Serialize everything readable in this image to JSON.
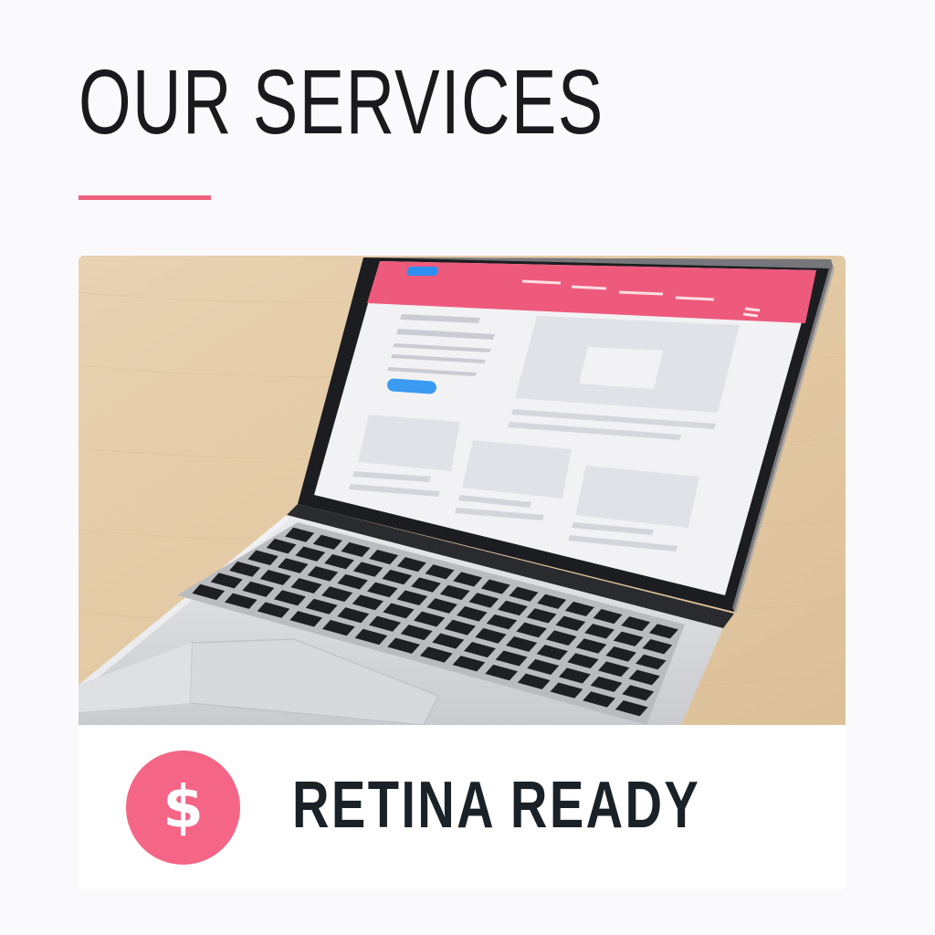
{
  "header": {
    "title": "OUR SERVICES",
    "accent_color": "#f0607e"
  },
  "service_card": {
    "image_description": "laptop on wooden desk showing a website mockup",
    "feature": {
      "icon": "dollar-icon",
      "icon_glyph": "$",
      "label": "RETINA READY",
      "icon_color": "#f56585"
    }
  }
}
